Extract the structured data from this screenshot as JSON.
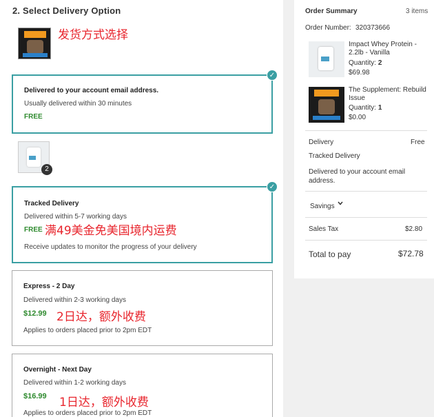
{
  "delivery": {
    "step_title": "2. Select Delivery Option",
    "annotation_top": "发货方式选择",
    "options": [
      {
        "title": "Delivered to your account email address.",
        "subtitle": "Usually delivered within 30 minutes",
        "price": "FREE",
        "selected": true
      },
      {
        "title": "Tracked Delivery",
        "subtitle": "Delivered within 5-7 working days",
        "price": "FREE",
        "note": "Receive updates to monitor the progress of your delivery",
        "annotation": "满49美金免美国境内运费",
        "selected": true
      },
      {
        "title": "Express - 2 Day",
        "subtitle": "Delivered within 2-3 working days",
        "price": "$12.99",
        "note": "Applies to orders placed prior to 2pm EDT",
        "annotation": "2日达，额外收费",
        "selected": false
      },
      {
        "title": "Overnight - Next Day",
        "subtitle": "Delivered within 1-2 working days",
        "price": "$16.99",
        "note": "Applies to orders placed prior to 2pm EDT",
        "annotation": "1日达，额外收费",
        "selected": false
      }
    ],
    "item_quantity_badge": "2"
  },
  "summary": {
    "title": "Order Summary",
    "count": "3 items",
    "order_number_label": "Order Number:",
    "order_number": "320373666",
    "items": [
      {
        "name": "Impact Whey Protein - 2.2lb - Vanilla",
        "quantity_label": "Quantity:",
        "quantity": "2",
        "price": "$69.98"
      },
      {
        "name": "The Supplement: Rebuild Issue",
        "quantity_label": "Quantity:",
        "quantity": "1",
        "price": "$0.00"
      }
    ],
    "delivery_label": "Delivery",
    "delivery_value": "Free",
    "delivery_method": "Tracked Delivery",
    "delivery_note": "Delivered to your account email address.",
    "savings_label": "Savings",
    "tax_label": "Sales Tax",
    "tax_value": "$2.80",
    "total_label": "Total to pay",
    "total_value": "$72.78"
  },
  "colors": {
    "accent": "#3a9fa3",
    "price_green": "#2e8a2e",
    "annotation_red": "#e8262e"
  },
  "icons": [
    "check-icon",
    "chevron-down-icon"
  ]
}
